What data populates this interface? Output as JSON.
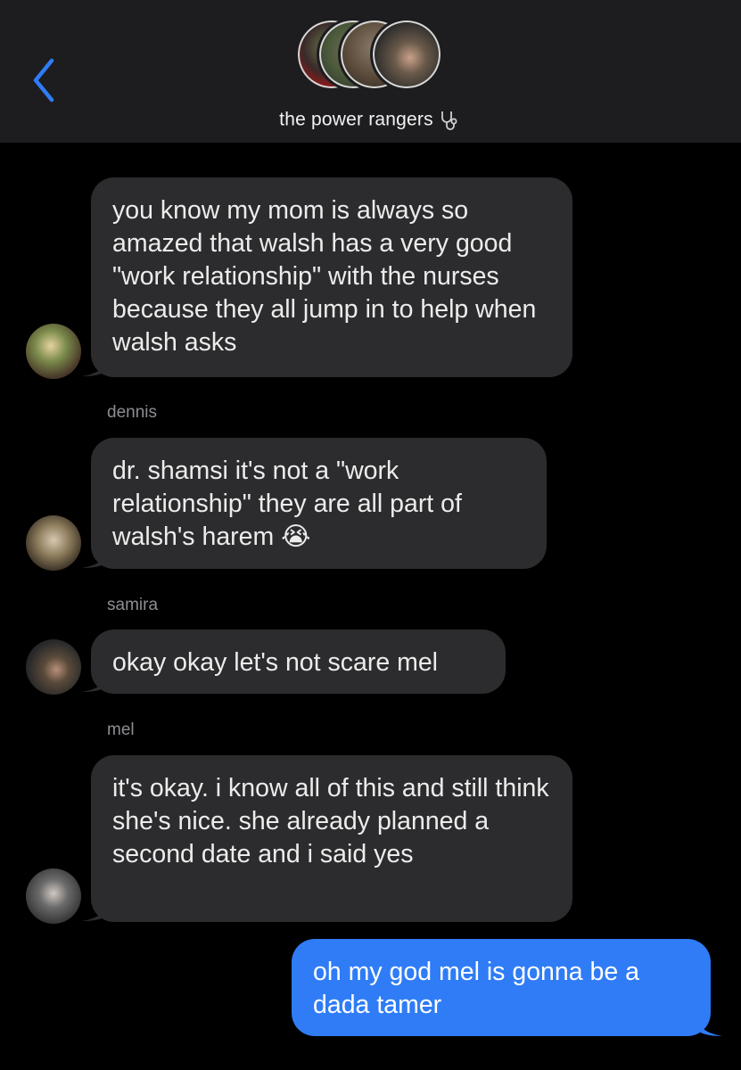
{
  "header": {
    "group_name": "the power rangers",
    "back_icon": "chevron-left-icon",
    "status_icon": "stethoscope-icon"
  },
  "messages": [
    {
      "sender": "",
      "text": "you know my mom is always so amazed that walsh has a very good \"work relationship\" with the nurses because they all jump in to help when walsh asks"
    },
    {
      "sender": "dennis",
      "text": "dr. shamsi it's not a \"work relationship\" they are all part of walsh's harem 😭"
    },
    {
      "sender": "samira",
      "text": "okay okay let's not scare mel"
    },
    {
      "sender": "mel",
      "text": "it's okay. i know all of this and still think she's nice. she already planned a second date and i said yes"
    },
    {
      "sender": "",
      "text": "oh my god mel is gonna be a dada tamer"
    }
  ],
  "colors": {
    "header_bg": "#1d1d1f",
    "incoming_bubble": "#2c2c2e",
    "outgoing_bubble": "#2f7cf6",
    "accent": "#2f7cf6"
  }
}
